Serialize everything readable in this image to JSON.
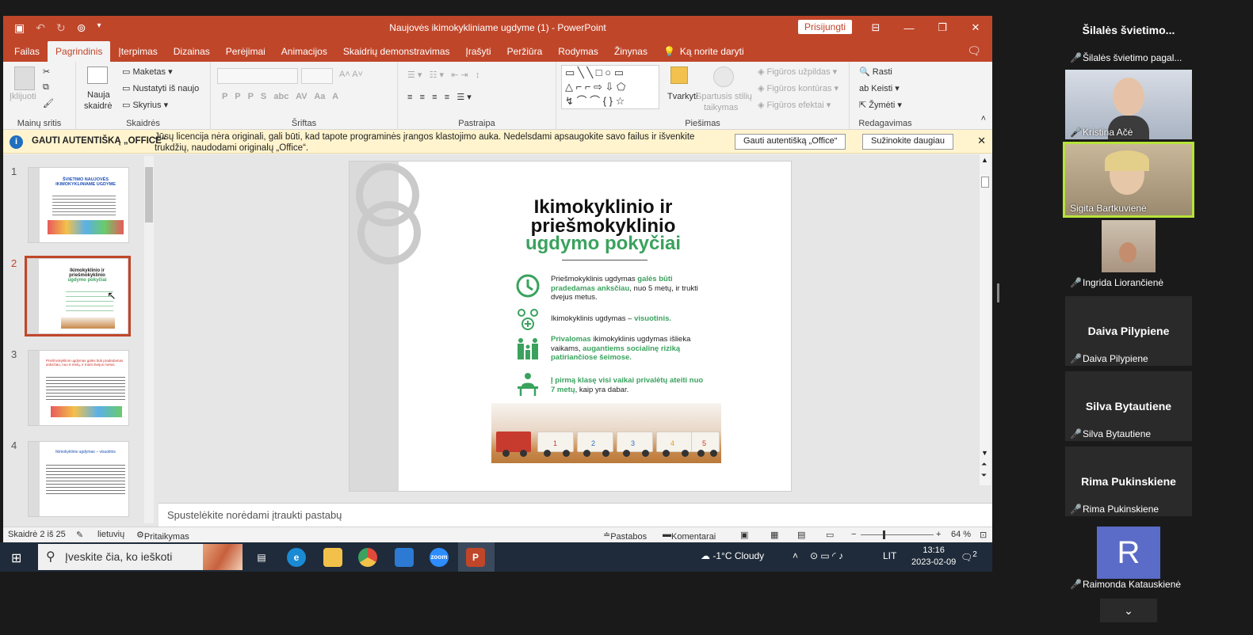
{
  "window": {
    "title": "Naujovės ikimokykliniame ugdyme (1) - PowerPoint",
    "signin": "Prisijungti"
  },
  "menu": {
    "tabs": [
      "Failas",
      "Pagrindinis",
      "Įterpimas",
      "Dizainas",
      "Perėjimai",
      "Animacijos",
      "Skaidrių demonstravimas",
      "Įrašyti",
      "Peržiūra",
      "Rodymas",
      "Žinynas"
    ],
    "tell": "Ką norite daryti"
  },
  "ribbon": {
    "paste": "Įklijuoti",
    "clipboard": "Mainų sritis",
    "new_slide": "Nauja",
    "new_slide2": "skaidrė",
    "layout": "Maketas",
    "reset": "Nustatyti iš naujo",
    "section": "Skyrius",
    "slides": "Skaidrės",
    "font": "Šriftas",
    "paragraph": "Pastraipa",
    "arrange": "Tvarkyti",
    "quick1": "Spartusis stilių",
    "quick2": "taikymas",
    "fill": "Figūros užpildas",
    "outline": "Figūros kontūras",
    "effects": "Figūros efektai",
    "drawing": "Piešimas",
    "find": "Rasti",
    "replace": "Keisti",
    "select": "Žymėti",
    "editing": "Redagavimas"
  },
  "infobar": {
    "head": "GAUTI AUTENTIŠKĄ „OFFICE“",
    "message": "Jūsų licencija nėra originali, gali būti, kad tapote programinės įrangos klastojimo auka. Nedelsdami apsaugokite savo failus ir išvenkite trukdžių, naudodami originalų „Office“.",
    "btn1": "Gauti autentišką „Office“",
    "btn2": "Sužinokite daugiau"
  },
  "thumbs": {
    "numbers": [
      "1",
      "2",
      "3",
      "4"
    ],
    "t1_title": "ŠVIETIMO NAUJOVĖS IKIMOKYKLINIAME UGDYME",
    "t2_title": "Ikimokyklinio ir priešmokyklinio",
    "t2_green": "ugdymo pokyčiai",
    "t3_title": "Priešmokyklinis ugdymas galės būti pradedamas anksčiau, nuo 5 metų, ir trukti dvejus metus.",
    "t4_title": "Ikimokyklinis ugdymas – visuotinis"
  },
  "slide": {
    "title1": "Ikimokyklinio ir",
    "title2": "priešmokyklinio",
    "title3": "ugdymo pokyčiai",
    "r1a": "Priešmokyklinis ugdymas ",
    "r1b": "galės būti pradedamas anksčiau",
    "r1c": ", nuo 5 metų, ir trukti dvejus metus.",
    "r2a": "Ikimokyklinis ugdymas – ",
    "r2b": "visuotinis.",
    "r3a": "Privalomas",
    "r3b": " ikimokyklinis ugdymas išlieka vaikams, ",
    "r3c": "augantiems socialinę riziką patiriančiose šeimose.",
    "r4a": "Į pirmą klasę visi vaikai privalėtų ateiti nuo 7 metų",
    "r4b": ", kaip yra dabar.",
    "cars": [
      "1",
      "2",
      "3",
      "4",
      "5"
    ]
  },
  "notes": "Spustelėkite norėdami įtraukti pastabų",
  "status": {
    "slide": "Skaidrė 2 iš 25",
    "lang": "lietuvių",
    "access": "Pritaikymas neįgaliesiems: peržiūrėkite rekomendacijas",
    "notes": "Pastabos",
    "comments": "Komentarai",
    "zoom": "64 %"
  },
  "taskbar": {
    "search": "Įveskite čia, ko ieškoti",
    "weather": "-1°C  Cloudy",
    "lang": "LIT",
    "time": "13:16",
    "date": "2023-02-09",
    "notif": "2"
  },
  "participants": {
    "title": "Šilalės švietimo...",
    "p0": "Šilalės švietimo pagal...",
    "p1": "Kristina Ačė",
    "p2": "Sigita Bartkuvienė",
    "p3": "Ingrida Liorančienė",
    "p4": "Daiva Pilypiene",
    "p5": "Silva Bytautiene",
    "p6": "Rima Pukinskiene",
    "p7": "Raimonda Katauskienė",
    "avatar_letter": "R"
  },
  "colors": {
    "accent": "#c0462a",
    "green": "#3aa25e",
    "speaking": "#b7e33a"
  }
}
